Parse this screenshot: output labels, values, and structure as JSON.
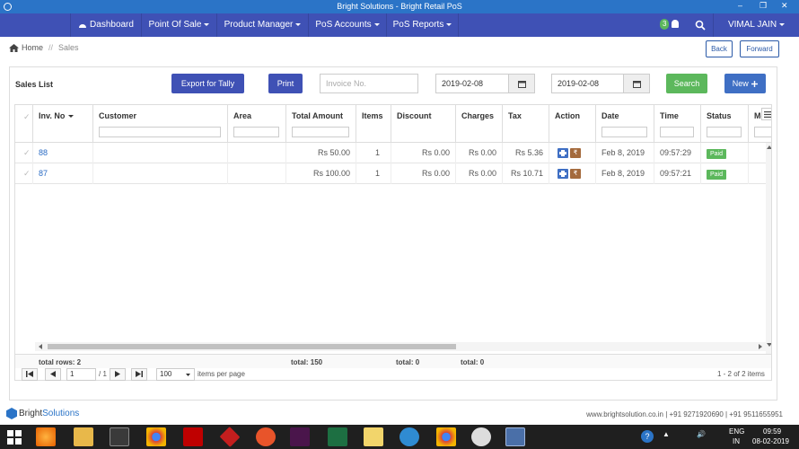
{
  "window": {
    "title": "Bright Solutions - Bright Retail PoS",
    "min": "–",
    "max": "❐",
    "close": "✕"
  },
  "nav": {
    "items": [
      {
        "label": "Dashboard",
        "icon": "dashboard-icon"
      },
      {
        "label": "Point Of Sale"
      },
      {
        "label": "Product Manager"
      },
      {
        "label": "PoS Accounts"
      },
      {
        "label": "PoS Reports"
      }
    ],
    "notification_count": "3",
    "user": "VIMAL JAIN"
  },
  "breadcrumb": {
    "home": "Home",
    "sep": "//",
    "current": "Sales"
  },
  "history": {
    "back": "Back",
    "forward": "Forward"
  },
  "panel": {
    "title": "Sales List",
    "export_label": "Export for Tally",
    "print_label": "Print",
    "invoice_placeholder": "Invoice No.",
    "date_from": "2019-02-08",
    "date_to": "2019-02-08",
    "search_label": "Search",
    "new_label": "New"
  },
  "table": {
    "columns": [
      "Inv. No",
      "Customer",
      "Area",
      "Total Amount",
      "Items",
      "Discount",
      "Charges",
      "Tax",
      "Action",
      "Date",
      "Time",
      "Status",
      "Mo"
    ],
    "rows": [
      {
        "inv": "88",
        "customer": "",
        "area": "",
        "total": "Rs 50.00",
        "items": "1",
        "discount": "Rs 0.00",
        "charges": "Rs 0.00",
        "tax": "Rs 5.36",
        "date": "Feb 8, 2019",
        "time": "09:57:29",
        "status": "Paid"
      },
      {
        "inv": "87",
        "customer": "",
        "area": "",
        "total": "Rs 100.00",
        "items": "1",
        "discount": "Rs 0.00",
        "charges": "Rs 0.00",
        "tax": "Rs 10.71",
        "date": "Feb 8, 2019",
        "time": "09:57:21",
        "status": "Paid"
      }
    ],
    "footer": {
      "total_rows": "total rows: 2",
      "total_amount": "total: 150",
      "total_discount": "total: 0",
      "total_charges": "total: 0"
    }
  },
  "pager": {
    "page": "1",
    "of": "/ 1",
    "per_page": "100",
    "per_page_label": "items per page",
    "summary": "1 - 2 of 2 items"
  },
  "brand": {
    "name_a": "Bright",
    "name_b": "Solutions",
    "contact": "www.brightsolution.co.in | +91 9271920690 | +91 9511655951"
  },
  "taskbar": {
    "lang": "ENG",
    "region": "IN",
    "time": "09:59",
    "date": "08-02-2019"
  }
}
